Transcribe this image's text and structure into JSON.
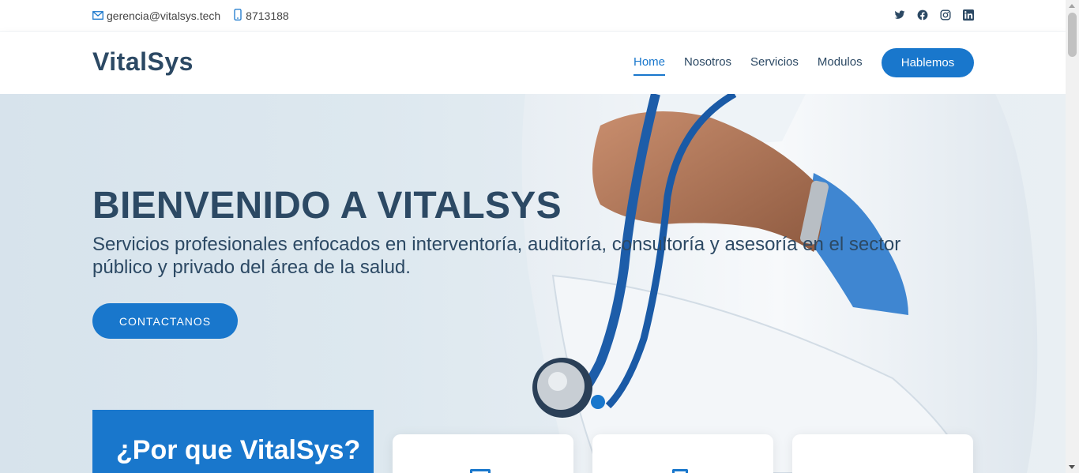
{
  "topbar": {
    "email": "gerencia@vitalsys.tech",
    "phone": "8713188",
    "social": [
      "twitter-icon",
      "facebook-icon",
      "instagram-icon",
      "linkedin-icon"
    ]
  },
  "header": {
    "logo": "VitalSys",
    "nav": [
      "Home",
      "Nosotros",
      "Servicios",
      "Modulos"
    ],
    "active_nav": "Home",
    "cta": "Hablemos"
  },
  "hero": {
    "title": "BIENVENIDO A VITALSYS",
    "subtitle": "Servicios profesionales enfocados en interventoría, auditoría, consultoría y asesoría en el sector público y privado del área de la salud.",
    "button": "CONTACTANOS"
  },
  "why": {
    "title": "¿Por que VitalSys?"
  },
  "colors": {
    "primary": "#1977cc",
    "heading": "#2c4964"
  }
}
